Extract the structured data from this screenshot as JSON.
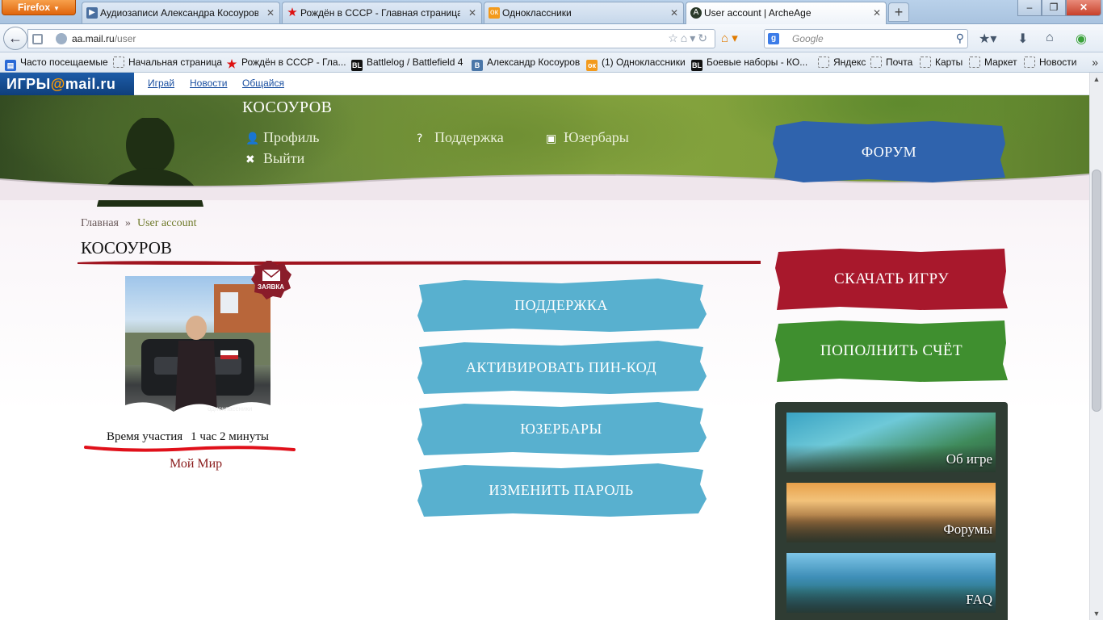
{
  "browser": {
    "app_button": "Firefox",
    "tabs": [
      {
        "label": "Аудиозаписи Александра Косоуров..."
      },
      {
        "label": "Рождён в СССР - Главная страница"
      },
      {
        "label": "Одноклассники"
      },
      {
        "label": "User account | ArcheAge"
      }
    ],
    "url_host": "aa.mail.ru",
    "url_path": "/user",
    "search_placeholder": "Google",
    "bookmarks": [
      "Часто посещаемые",
      "Начальная страница",
      "Рождён в СССР - Гла...",
      "Battlelog / Battlefield 4",
      "Александр Косоуров",
      "(1) Одноклассники",
      "Боевые наборы - КО...",
      "Яндекс",
      "Почта",
      "Карты",
      "Маркет",
      "Новости"
    ]
  },
  "mailbar": {
    "logo_a": "ИГРЫ",
    "logo_b": "@",
    "logo_c": "mail.ru",
    "links": [
      "Играй",
      "Новости",
      "Общайся"
    ]
  },
  "header": {
    "username": "КОСОУРОВ",
    "profile": "Профиль",
    "logout": "Выйти",
    "support": "Поддержка",
    "userbars": "Юзербары",
    "forum": "ФОРУМ"
  },
  "breadcrumb": {
    "home": "Главная",
    "sep": "»",
    "current": "User account"
  },
  "page_title": "КОСОУРОВ",
  "profile": {
    "tag": "ЗАЯВКА",
    "photo_watermark": "одноклассники",
    "time_label": "Время участия",
    "time_value": "1 час 2 минуты",
    "my_world": "Мой Мир"
  },
  "actions": [
    "ПОДДЕРЖКА",
    "АКТИВИРОВАТЬ ПИН-КОД",
    "ЮЗЕРБАРЫ",
    "ИЗМЕНИТЬ ПАРОЛЬ"
  ],
  "sidebar": {
    "download": "СКАЧАТЬ ИГРУ",
    "topup": "ПОПОЛНИТЬ СЧЁТ",
    "cards": [
      "Об игре",
      "Форумы",
      "FAQ"
    ]
  },
  "colors": {
    "action_blue": "#58b0cf",
    "forum_blue": "#2f63ad",
    "download_red": "#a8182c",
    "topup_green": "#3f8f2f",
    "title_rule": "#a0141f"
  }
}
